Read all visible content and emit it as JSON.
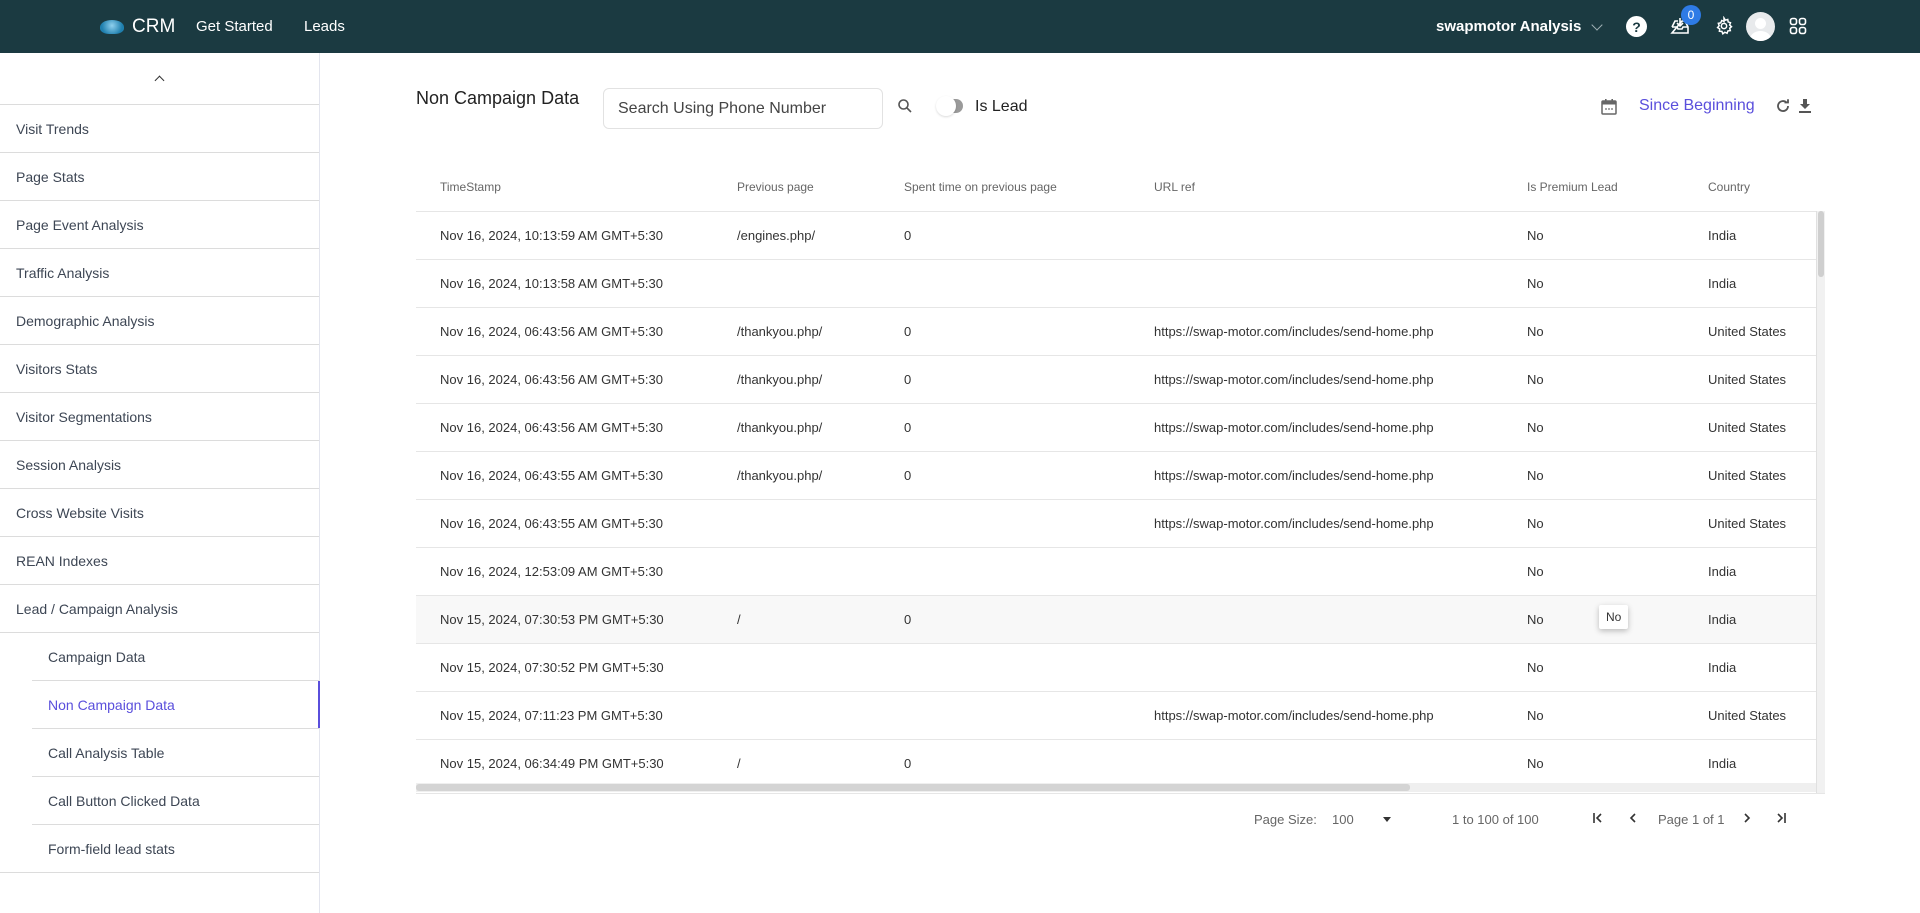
{
  "header": {
    "brand": "CRM",
    "nav": [
      "Get Started",
      "Leads"
    ],
    "account": "swapmotor Analysis",
    "notification_count": "0",
    "help_glyph": "?"
  },
  "sidebar": {
    "items": [
      {
        "label": "Visit Trends"
      },
      {
        "label": "Page Stats"
      },
      {
        "label": "Page Event Analysis"
      },
      {
        "label": "Traffic Analysis"
      },
      {
        "label": "Demographic Analysis"
      },
      {
        "label": "Visitors Stats"
      },
      {
        "label": "Visitor Segmentations"
      },
      {
        "label": "Session Analysis"
      },
      {
        "label": "Cross Website Visits"
      },
      {
        "label": "REAN Indexes"
      },
      {
        "label": "Lead / Campaign Analysis"
      }
    ],
    "sub_items": [
      {
        "label": "Campaign Data"
      },
      {
        "label": "Non Campaign Data",
        "active": true
      },
      {
        "label": "Call Analysis Table"
      },
      {
        "label": "Call Button Clicked Data"
      },
      {
        "label": "Form-field lead stats"
      }
    ]
  },
  "main": {
    "title": "Non Campaign Data",
    "search_placeholder": "Search Using Phone Number",
    "toggle_label": "Is Lead",
    "toggle_on": false,
    "date_range": "Since Beginning",
    "accent_color": "#5a4fdc"
  },
  "table": {
    "columns": [
      "TimeStamp",
      "Previous page",
      "Spent time on previous page",
      "URL ref",
      "Is Premium Lead",
      "Country"
    ],
    "rows": [
      [
        "Nov 16, 2024, 10:13:59 AM GMT+5:30",
        "/engines.php/",
        "0",
        "",
        "No",
        "India"
      ],
      [
        "Nov 16, 2024, 10:13:58 AM GMT+5:30",
        "",
        "",
        "",
        "No",
        "India"
      ],
      [
        "Nov 16, 2024, 06:43:56 AM GMT+5:30",
        "/thankyou.php/",
        "0",
        "https://swap-motor.com/includes/send-home.php",
        "No",
        "United States"
      ],
      [
        "Nov 16, 2024, 06:43:56 AM GMT+5:30",
        "/thankyou.php/",
        "0",
        "https://swap-motor.com/includes/send-home.php",
        "No",
        "United States"
      ],
      [
        "Nov 16, 2024, 06:43:56 AM GMT+5:30",
        "/thankyou.php/",
        "0",
        "https://swap-motor.com/includes/send-home.php",
        "No",
        "United States"
      ],
      [
        "Nov 16, 2024, 06:43:55 AM GMT+5:30",
        "/thankyou.php/",
        "0",
        "https://swap-motor.com/includes/send-home.php",
        "No",
        "United States"
      ],
      [
        "Nov 16, 2024, 06:43:55 AM GMT+5:30",
        "",
        "",
        "https://swap-motor.com/includes/send-home.php",
        "No",
        "United States"
      ],
      [
        "Nov 16, 2024, 12:53:09 AM GMT+5:30",
        "",
        "",
        "",
        "No",
        "India"
      ],
      [
        "Nov 15, 2024, 07:30:53 PM GMT+5:30",
        "/",
        "0",
        "",
        "No",
        "India"
      ],
      [
        "Nov 15, 2024, 07:30:52 PM GMT+5:30",
        "",
        "",
        "",
        "No",
        "India"
      ],
      [
        "Nov 15, 2024, 07:11:23 PM GMT+5:30",
        "",
        "",
        "https://swap-motor.com/includes/send-home.php",
        "No",
        "United States"
      ],
      [
        "Nov 15, 2024, 06:34:49 PM GMT+5:30",
        "/",
        "0",
        "",
        "No",
        "India"
      ]
    ],
    "hovered_row": 8,
    "tooltip": "No"
  },
  "pagination": {
    "page_size_label": "Page Size:",
    "page_size": "100",
    "range": "1 to 100 of 100",
    "page_info": "Page 1 of 1"
  }
}
